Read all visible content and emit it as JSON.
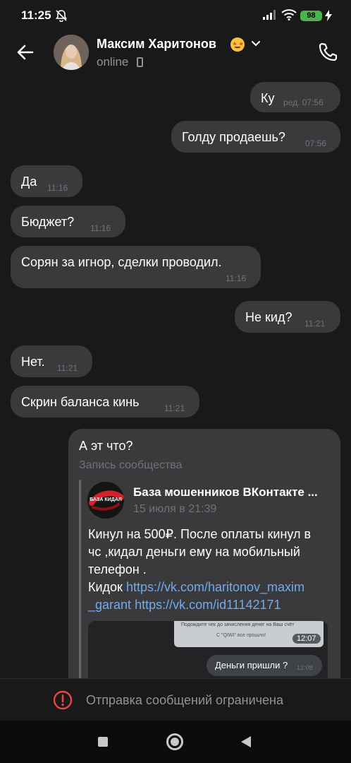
{
  "status_bar": {
    "time": "11:25",
    "battery": "98"
  },
  "header": {
    "name": "Максим Харитонов",
    "status": "online"
  },
  "messages": [
    {
      "text": "Ку",
      "time": "ред. 07:56",
      "side": "out"
    },
    {
      "text": "Голду продаешь?",
      "time": "07:56",
      "side": "out"
    },
    {
      "text": "Да",
      "time": "11:16",
      "side": "in"
    },
    {
      "text": "Бюджет?",
      "time": "11:16",
      "side": "in"
    },
    {
      "text": "Сорян за игнор, сделки проводил.",
      "time": "11:16",
      "side": "in"
    },
    {
      "text": "Не кид?",
      "time": "11:21",
      "side": "out"
    },
    {
      "text": "Нет.",
      "time": "11:21",
      "side": "in"
    },
    {
      "text": "Скрин баланса кинь",
      "time": "11:21",
      "side": "in"
    }
  ],
  "forwarded": {
    "text": "А эт что?",
    "subtitle": "Запись сообщества",
    "post": {
      "community": "База мошенников ВКонтакте ...",
      "logo_text": "БАЗА КИДАЛ",
      "date": "15 июля в 21:39",
      "body_line1": "Кинул на 500₽. После оплаты кинул в",
      "body_line2": "чс ,кидал деньги ему на мобильный",
      "body_line3": "телефон .",
      "body_prefix": "Кидок ",
      "link1_part1": "https://vk.com/haritonov_maxim",
      "link1_part2": "_garant",
      "link2": "https://vk.com/id11142171",
      "image": {
        "screenshot_line1": "Подождите чек до зачисления денег на Ваш счёт",
        "screenshot_line2": "С \"QIWI\" все прошло!",
        "time": "12:07",
        "bubble_text": "Деньги пришли ?",
        "bubble_time": "12:08"
      }
    }
  },
  "footer": {
    "restricted_text": "Отправка сообщений ограничена"
  },
  "colors": {
    "background": "#19191a",
    "bubble": "#3a3a3c",
    "link": "#71aaeb",
    "warning": "#e64646",
    "muted": "#6f7378"
  }
}
